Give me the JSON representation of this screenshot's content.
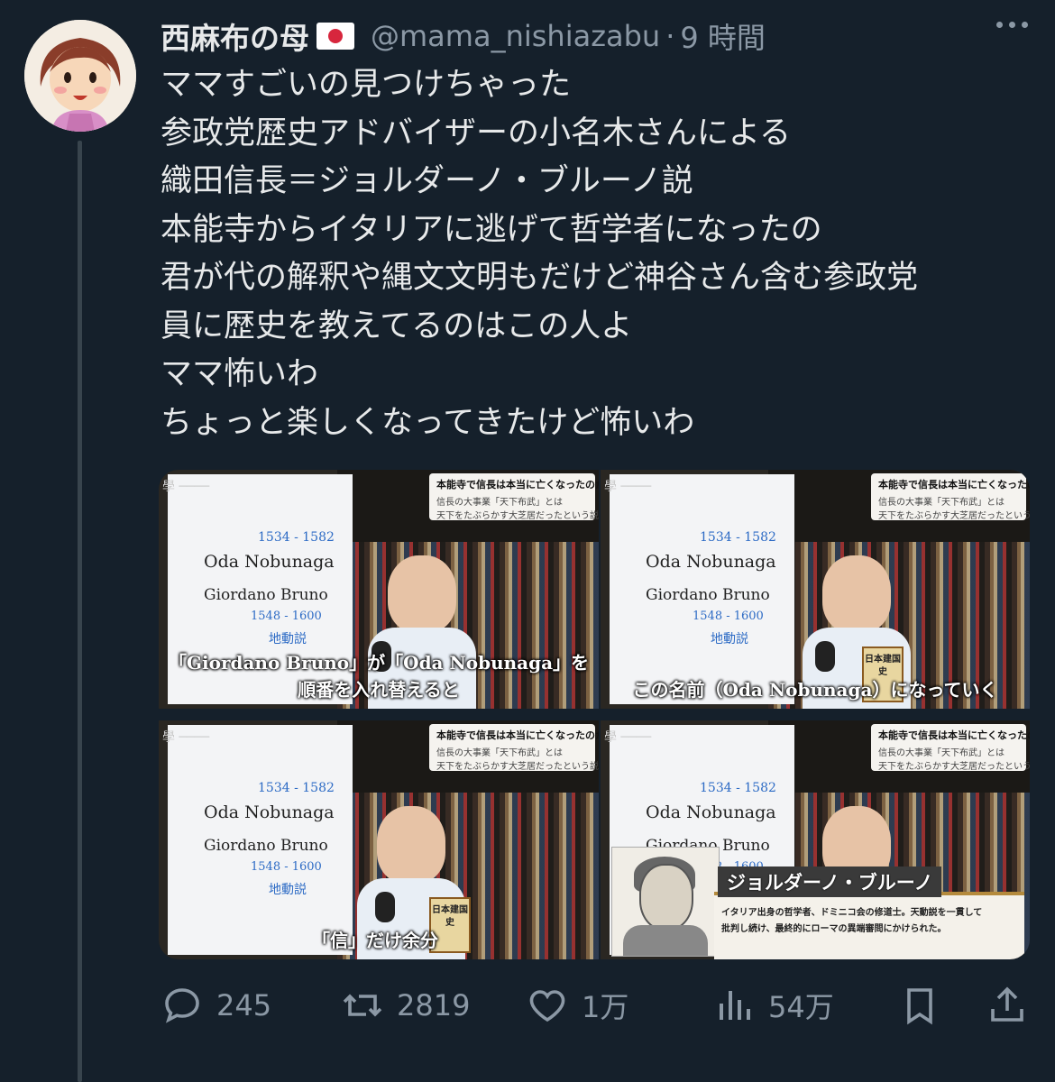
{
  "tweet": {
    "author_name": "西麻布の母",
    "handle": "@mama_nishiazabu",
    "separator": "·",
    "time": "9 時間",
    "lines": [
      "ママすごいの見つけちゃった",
      "参政党歴史アドバイザーの小名木さんによる",
      "織田信長＝ジョルダーノ・ブルーノ説",
      "本能寺からイタリアに逃げて哲学者になったの",
      "君が代の解釈や縄文文明もだけど神谷さん含む参政党",
      "員に歴史を教えてるのはこの人よ",
      "ママ怖いわ",
      "ちょっと楽しくなってきたけど怖いわ"
    ]
  },
  "media": {
    "banner_title": "本能寺で信長は本当に亡くなったのか",
    "banner_sub1": "信長の大事業「天下布武」とは",
    "banner_sub2": "天下をたぶらかす大芝居だったという説",
    "board": {
      "years": "1534 - 1582",
      "oda": "Oda Nobunaga",
      "giordano": "Giordano Bruno",
      "years2": "1548 - 1600",
      "kanji": "地動説"
    },
    "frame1_caption_line1": "「Giordano Bruno」が「Oda Nobunaga」を",
    "frame1_caption_line2": "順番を入れ替えると",
    "frame2_caption": "この名前（Oda Nobunaga）になっていく",
    "frame3_caption": "「信」だけ余分",
    "book_label": "日本建国史",
    "frame4_title": "ジョルダーノ・ブルーノ",
    "frame4_desc1": "イタリア出身の哲学者、ドミニコ会の修道士。天動説を一貫して",
    "frame4_desc2": "批判し続け、最終的にローマの異端審問にかけられた。"
  },
  "actions": {
    "replies": "245",
    "retweets": "2819",
    "likes": "1万",
    "views": "54万"
  },
  "icons": {
    "reply": "speech-bubble-icon",
    "retweet": "retweet-arrows-icon",
    "like": "heart-icon",
    "views": "bar-chart-icon",
    "bookmark": "bookmark-icon",
    "share": "share-upload-icon",
    "more": "ellipsis-icon",
    "flag": "japan-flag-icon"
  },
  "colors": {
    "background": "#15202b",
    "text": "#e7e9ea",
    "secondary": "#8b98a5"
  }
}
